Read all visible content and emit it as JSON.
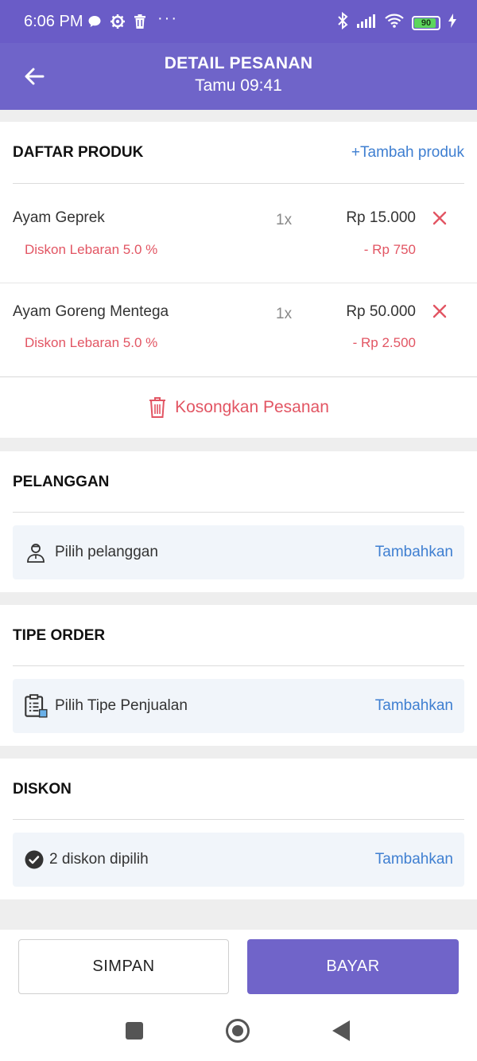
{
  "status_bar": {
    "time": "6:06 PM",
    "dots": "···",
    "battery": "90",
    "icons": [
      "chat-bubble-icon",
      "gear-icon",
      "trash-icon",
      "bluetooth-icon",
      "signal-icon",
      "wifi-icon",
      "battery-icon",
      "charging-icon"
    ]
  },
  "header": {
    "title": "DETAIL PESANAN",
    "subtitle": "Tamu 09:41"
  },
  "products": {
    "section_title": "DAFTAR PRODUK",
    "add_label": "+Tambah produk",
    "items": [
      {
        "name": "Ayam Geprek",
        "qty": "1x",
        "price": "Rp 15.000",
        "discount_name": "Diskon Lebaran 5.0 %",
        "discount_value": "- Rp 750"
      },
      {
        "name": "Ayam Goreng Mentega",
        "qty": "1x",
        "price": "Rp 50.000",
        "discount_name": "Diskon Lebaran 5.0 %",
        "discount_value": "- Rp 2.500"
      }
    ],
    "clear_label": "Kosongkan Pesanan"
  },
  "customer": {
    "section_title": "PELANGGAN",
    "pick_label": "Pilih pelanggan",
    "action_label": "Tambahkan"
  },
  "order_type": {
    "section_title": "TIPE ORDER",
    "pick_label": "Pilih Tipe Penjualan",
    "action_label": "Tambahkan"
  },
  "discount": {
    "section_title": "DISKON",
    "pick_label": "2 diskon dipilih",
    "action_label": "Tambahkan"
  },
  "footer": {
    "save_label": "SIMPAN",
    "pay_label": "BAYAR"
  },
  "colors": {
    "primary": "#6f64c9",
    "accent_link": "#3f7fd1",
    "danger": "#e25563"
  }
}
